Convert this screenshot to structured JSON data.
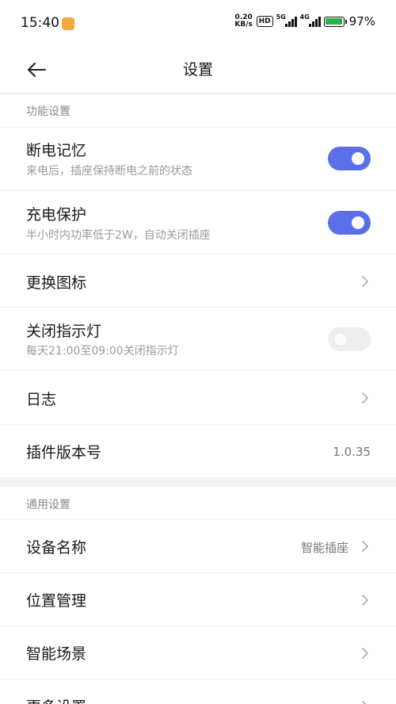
{
  "status_bar": {
    "time": "15:40",
    "net_speed_value": "0.20",
    "net_speed_unit": "KB/s",
    "hd_label": "HD",
    "signal_1_label": "5G",
    "signal_2_label": "4G",
    "battery_percent": "97%",
    "battery_level": 0.97,
    "battery_color": "#2fb14a"
  },
  "header": {
    "title": "设置",
    "back_icon": "arrow-left-icon"
  },
  "sections": {
    "function": {
      "title": "功能设置",
      "power_memory": {
        "title": "断电记忆",
        "subtitle": "来电后，插座保持断电之前的状态",
        "enabled": true
      },
      "charge_protect": {
        "title": "充电保护",
        "subtitle": "半小时内功率低于2W，自动关闭插座",
        "enabled": true
      },
      "change_icon": {
        "title": "更换图标"
      },
      "indicator_light": {
        "title": "关闭指示灯",
        "subtitle": "每天21:00至09:00关闭指示灯",
        "enabled": false
      },
      "log": {
        "title": "日志"
      },
      "plugin_version": {
        "title": "插件版本号",
        "value": "1.0.35"
      }
    },
    "general": {
      "title": "通用设置",
      "device_name": {
        "title": "设备名称",
        "value": "智能插座"
      },
      "location": {
        "title": "位置管理"
      },
      "smart_scene": {
        "title": "智能场景"
      },
      "more_settings": {
        "title": "更多设置"
      }
    }
  },
  "colors": {
    "toggle_on": "#5b6fe8",
    "toggle_off": "#eeeeee",
    "section_background": "#f4f4f6"
  }
}
